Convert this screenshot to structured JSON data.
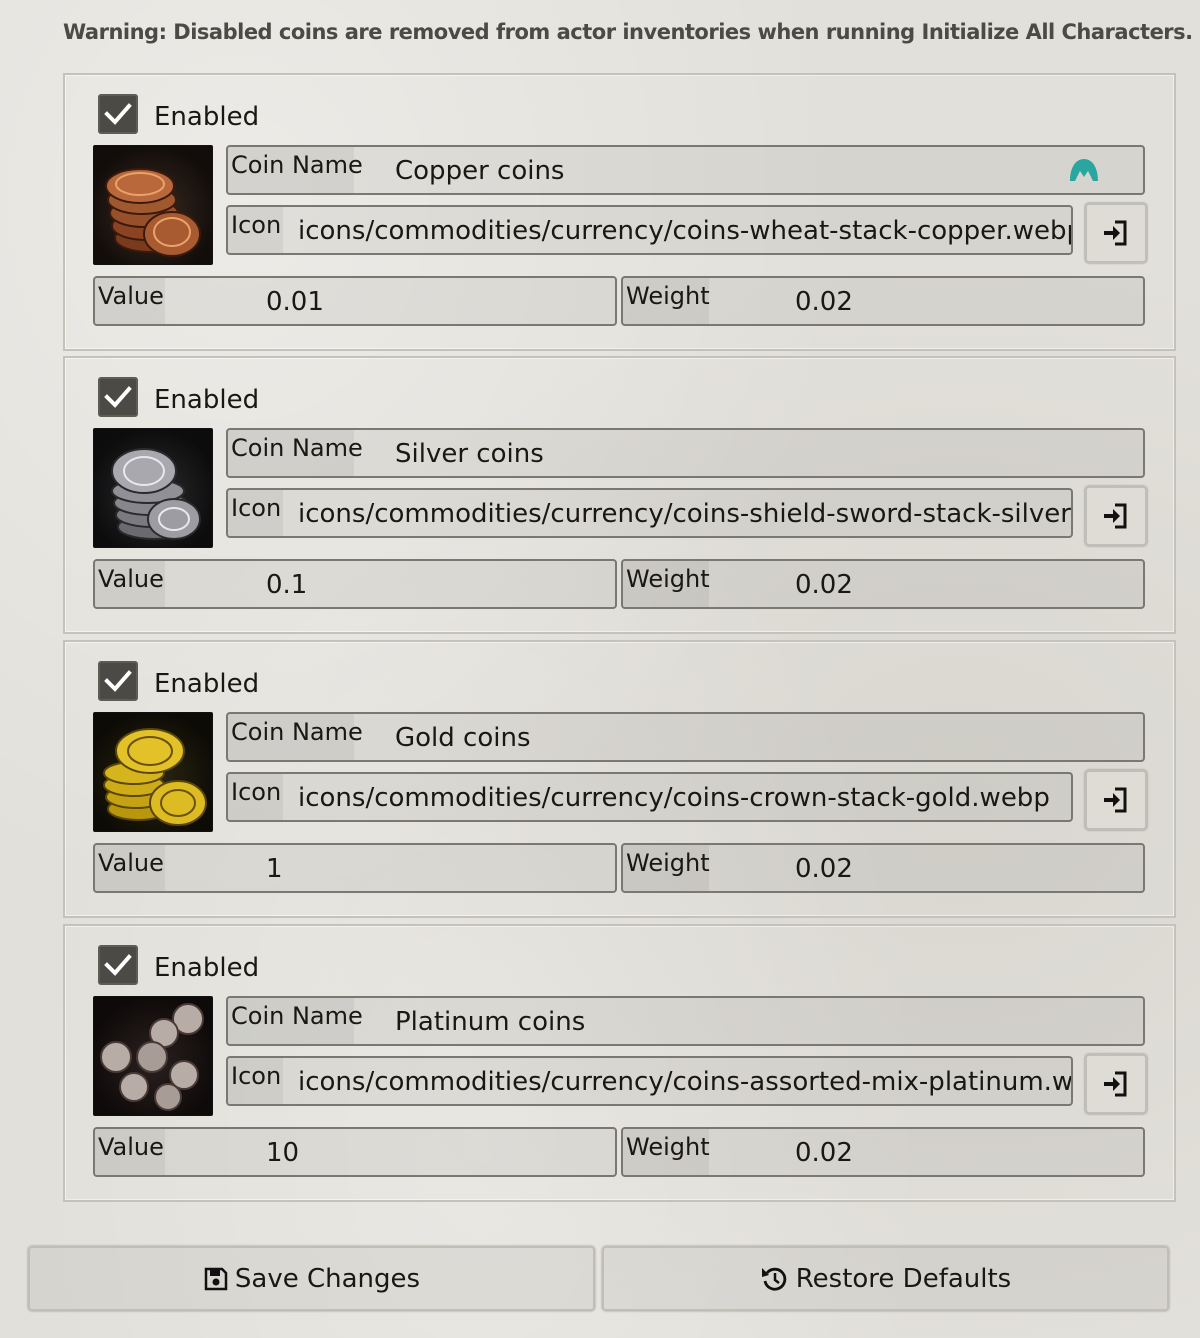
{
  "warning": "Warning: Disabled coins are removed from actor inventories when running Initialize All Characters.",
  "labels": {
    "enabled": "Enabled",
    "coin_name": "Coin Name",
    "icon": "Icon",
    "value": "Value",
    "weight": "Weight"
  },
  "coins": [
    {
      "enabled": true,
      "name": "Copper coins",
      "icon": "icons/commodities/currency/coins-wheat-stack-copper.webp",
      "value": "0.01",
      "weight": "0.02",
      "thumb_color": "#a0522d"
    },
    {
      "enabled": true,
      "name": "Silver coins",
      "icon": "icons/commodities/currency/coins-shield-sword-stack-silver.webp",
      "value": "0.1",
      "weight": "0.02",
      "thumb_color": "#9a9a9e"
    },
    {
      "enabled": true,
      "name": "Gold coins",
      "icon": "icons/commodities/currency/coins-crown-stack-gold.webp",
      "value": "1",
      "weight": "0.02",
      "thumb_color": "#d4b21a"
    },
    {
      "enabled": true,
      "name": "Platinum coins",
      "icon": "icons/commodities/currency/coins-assorted-mix-platinum.webp",
      "value": "10",
      "weight": "0.02",
      "thumb_color": "#b8aca6"
    }
  ],
  "buttons": {
    "save": "Save Changes",
    "restore": "Restore Defaults"
  },
  "icons": {
    "checkbox": "check-icon",
    "picker": "file-import-icon",
    "save": "floppy-disk-icon",
    "restore": "rotate-left-icon",
    "extension": "nordpass-icon"
  },
  "colors": {
    "accent": "#4b4a44",
    "nord_icon": "#2aa6a0"
  }
}
